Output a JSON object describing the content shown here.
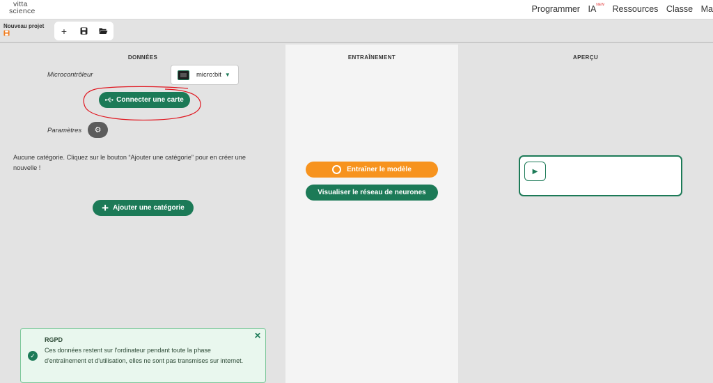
{
  "app": {
    "logo_line1": "vitta",
    "logo_line2": "science"
  },
  "nav": {
    "items": [
      "Programmer",
      "IA",
      "Ressources",
      "Classe",
      "Ma"
    ],
    "ia_badge": "NEW"
  },
  "toolbar": {
    "project_name": "Nouveau projet",
    "save_icon": "save-icon",
    "new_icon": "plus-icon",
    "save_button_icon": "floppy-icon",
    "open_icon": "folder-open-icon"
  },
  "panels": {
    "data_title": "DONNÉES",
    "training_title": "ENTRAÎNEMENT",
    "preview_title": "APERÇU"
  },
  "data": {
    "microcontroller_label": "Microcontrôleur",
    "microcontroller_value": "micro:bit",
    "connect_button": "Connecter une carte",
    "parameters_label": "Paramètres",
    "empty_message": "Aucune catégorie. Cliquez sur le bouton “Ajouter une catégorie” pour en créer une nouvelle !",
    "add_category_button": "Ajouter une catégorie"
  },
  "training": {
    "train_button": "Entraîner le modèle",
    "visualize_button": "Visualiser le réseau de neurones"
  },
  "toast": {
    "title": "RGPD",
    "body": "Ces données restent sur l'ordinateur pendant toute la phase d'entraînement et d'utilisation, elles ne sont pas transmises sur internet."
  },
  "colors": {
    "primary_green": "#1c7a57",
    "orange": "#f7931e",
    "annotation_red": "#e0161f"
  }
}
